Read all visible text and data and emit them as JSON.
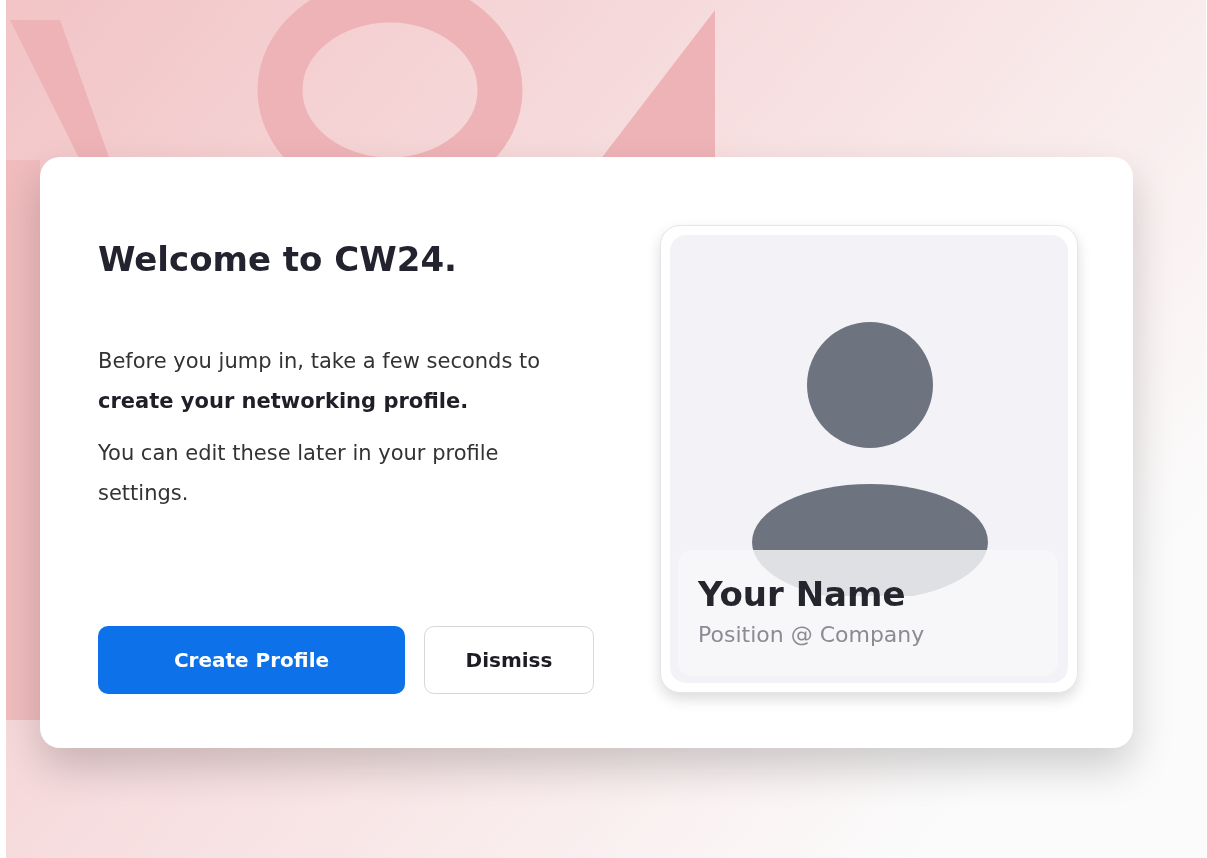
{
  "dialog": {
    "title": "Welcome to CW24.",
    "paragraphs": [
      "Before you jump in, take a few seconds to **create your networking profile.**",
      "You can edit these later in your profile settings."
    ],
    "buttons": [
      {
        "label": "Create Profile",
        "kind": "primary"
      },
      {
        "label": "Dismiss",
        "kind": "secondary"
      }
    ]
  },
  "preview": {
    "name": "Your Name",
    "subtitle": "Position @ Company"
  }
}
